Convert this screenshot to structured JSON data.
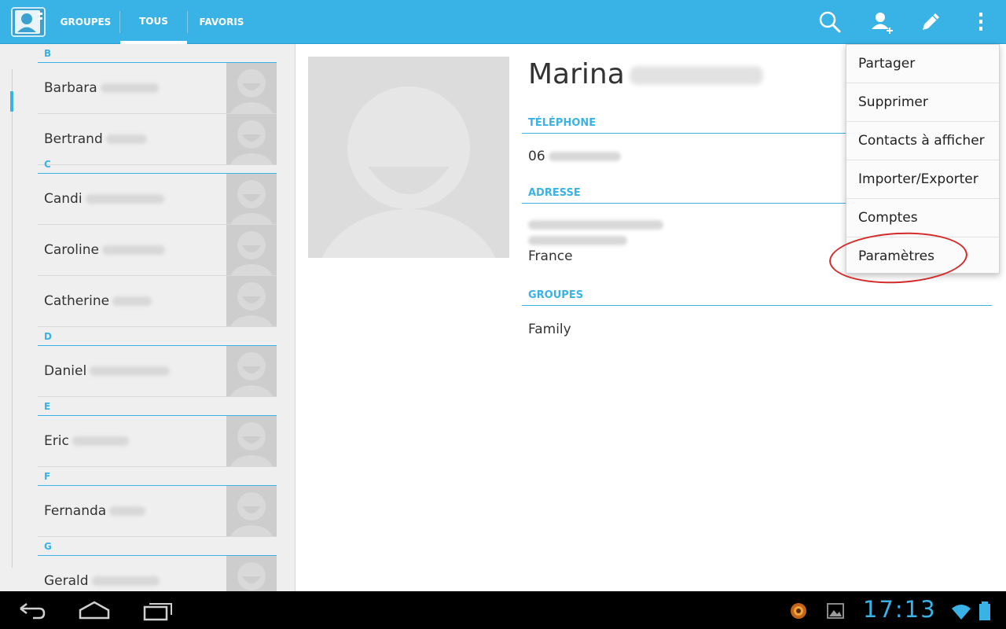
{
  "tabs": [
    {
      "label": "GROUPES",
      "active": false
    },
    {
      "label": "TOUS",
      "active": true
    },
    {
      "label": "FAVORIS",
      "active": false
    }
  ],
  "actionbar_icons": [
    "search-icon",
    "add-contact-icon",
    "edit-icon",
    "overflow-menu-icon"
  ],
  "contacts": {
    "sections": [
      {
        "letter": "B",
        "items": [
          {
            "first_name": "Barbara"
          },
          {
            "first_name": "Bertrand"
          }
        ]
      },
      {
        "letter": "C",
        "items": [
          {
            "first_name": "Candi"
          },
          {
            "first_name": "Caroline"
          },
          {
            "first_name": "Catherine"
          }
        ]
      },
      {
        "letter": "D",
        "items": [
          {
            "first_name": "Daniel"
          }
        ]
      },
      {
        "letter": "E",
        "items": [
          {
            "first_name": "Eric"
          }
        ]
      },
      {
        "letter": "F",
        "items": [
          {
            "first_name": "Fernanda"
          }
        ]
      },
      {
        "letter": "G",
        "items": [
          {
            "first_name": "Gerald"
          }
        ]
      }
    ]
  },
  "detail": {
    "first_name": "Marina",
    "phone_header": "TÉLÉPHONE",
    "phone_prefix": "06",
    "address_header": "ADRESSE",
    "address_country": "France",
    "groups_header": "GROUPES",
    "group": "Family"
  },
  "menu": {
    "items": [
      "Partager",
      "Supprimer",
      "Contacts à afficher",
      "Importer/Exporter",
      "Comptes",
      "Paramètres"
    ],
    "highlighted": "Paramètres"
  },
  "navbar": {
    "clock": "17:13",
    "icons": [
      "back-icon",
      "home-icon",
      "recent-apps-icon",
      "app-notification-icon",
      "gallery-icon",
      "wifi-icon",
      "battery-icon"
    ]
  },
  "colors": {
    "accent": "#39b3e6",
    "highlight_ring": "#d42a2a"
  }
}
